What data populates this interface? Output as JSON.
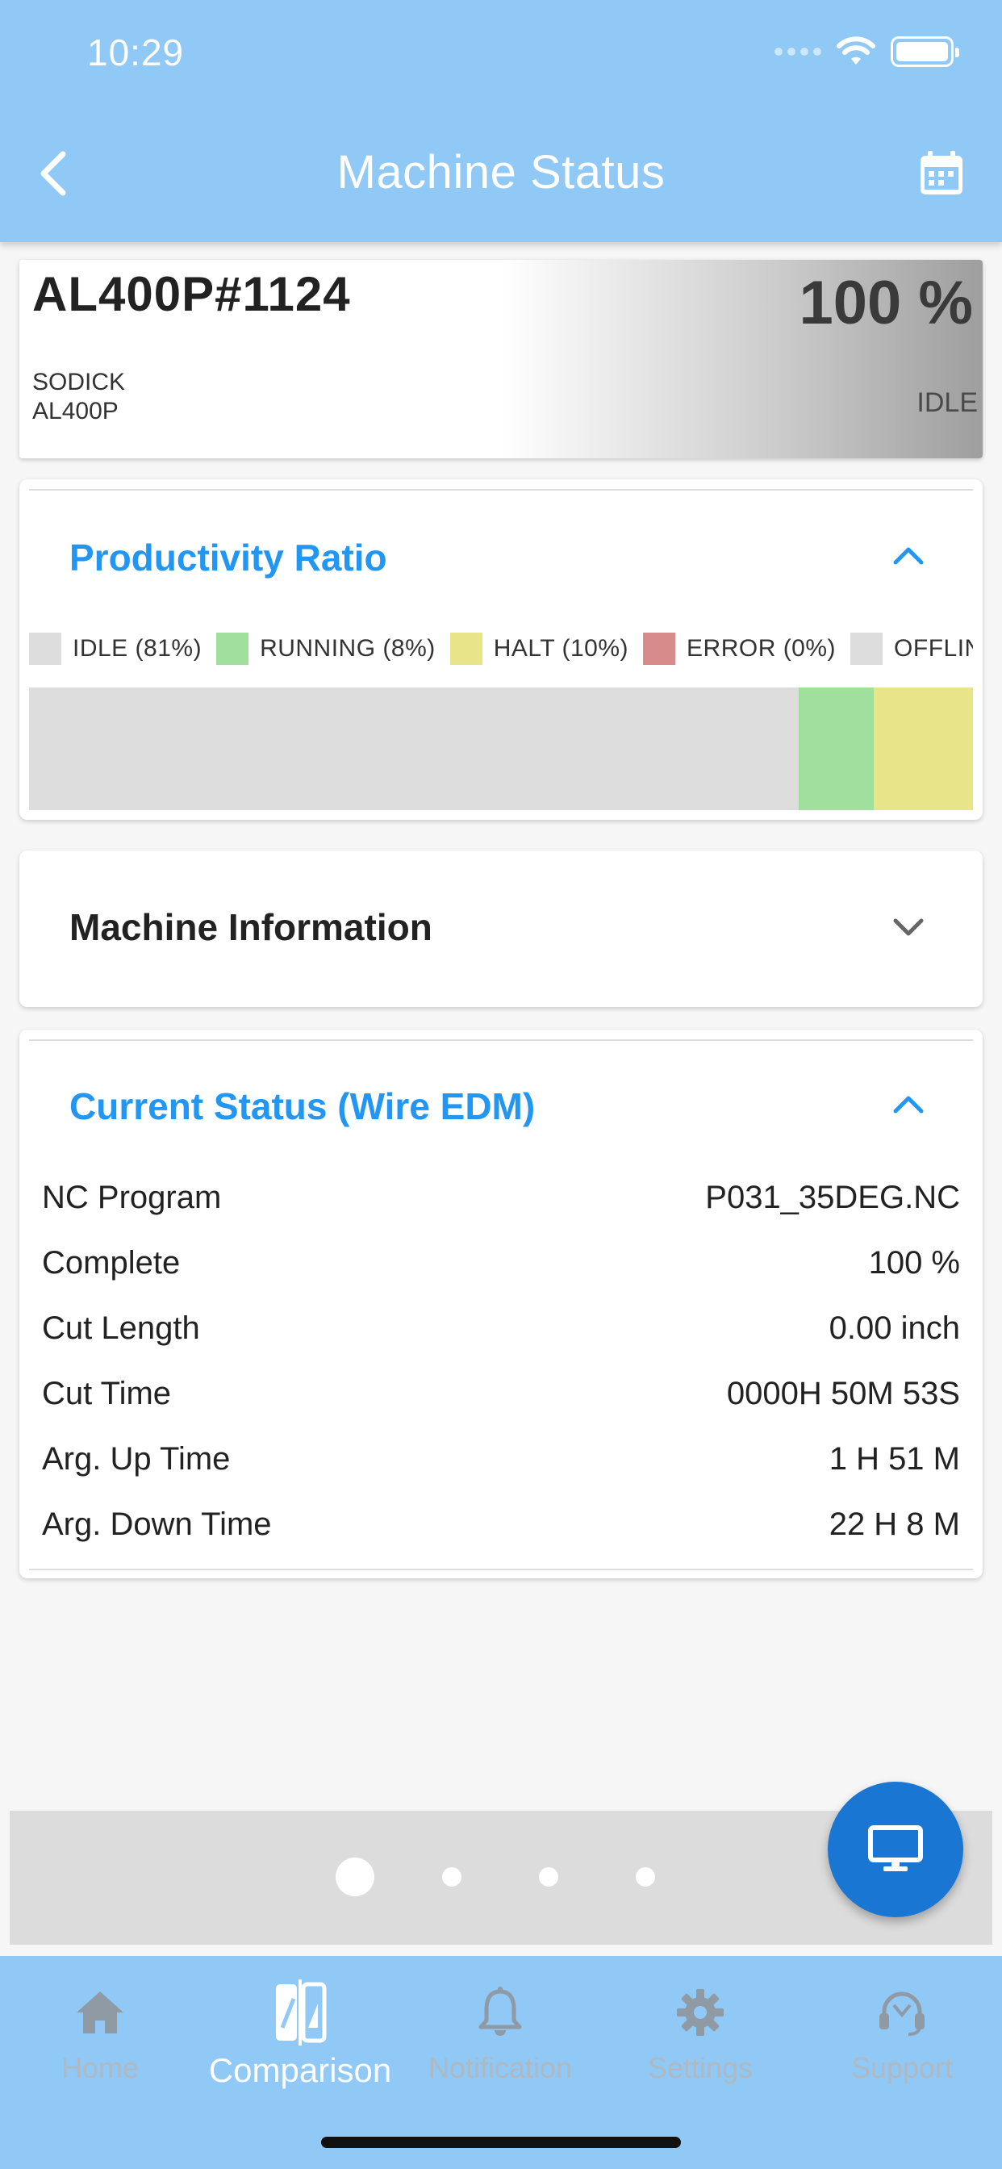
{
  "status_bar": {
    "time": "10:29"
  },
  "header": {
    "title": "Machine Status"
  },
  "machine": {
    "id": "AL400P#1124",
    "brand": "SODICK",
    "model": "AL400P",
    "percent": "100 %",
    "state": "IDLE"
  },
  "productivity": {
    "title": "Productivity Ratio",
    "legend": [
      {
        "label": "IDLE (81%)",
        "color": "#dddddd"
      },
      {
        "label": "RUNNING (8%)",
        "color": "#a0e09c"
      },
      {
        "label": "HALT (10%)",
        "color": "#e7e48a"
      },
      {
        "label": "ERROR (0%)",
        "color": "#d88b8b"
      },
      {
        "label": "OFFLINE",
        "color": "#dddddd"
      }
    ],
    "segments": [
      {
        "name": "idle",
        "fraction": 0.815,
        "color": "#dddddd"
      },
      {
        "name": "running",
        "fraction": 0.08,
        "color": "#a0e09c"
      },
      {
        "name": "halt",
        "fraction": 0.105,
        "color": "#e7e48a"
      }
    ]
  },
  "machine_info": {
    "title": "Machine Information"
  },
  "current_status": {
    "title": "Current Status (Wire EDM)",
    "rows": [
      {
        "label": "NC Program",
        "value": "P031_35DEG.NC"
      },
      {
        "label": "Complete",
        "value": "100 %"
      },
      {
        "label": "Cut Length",
        "value": "0.00 inch"
      },
      {
        "label": "Cut Time",
        "value": "0000H 50M 53S"
      },
      {
        "label": "Arg. Up Time",
        "value": "1 H 51 M"
      },
      {
        "label": "Arg. Down Time",
        "value": "22 H 8 M"
      }
    ]
  },
  "pager": {
    "active_index": 0,
    "count": 4
  },
  "nav": {
    "items": [
      {
        "label": "Home",
        "icon": "home-icon"
      },
      {
        "label": "Comparison",
        "icon": "comparison-icon"
      },
      {
        "label": "Notification",
        "icon": "bell-icon"
      },
      {
        "label": "Settings",
        "icon": "gear-icon"
      },
      {
        "label": "Support",
        "icon": "headset-icon"
      }
    ],
    "active": "Comparison"
  },
  "colors": {
    "header": "#90c8f6",
    "accent": "#2196f3",
    "fab": "#1976d2"
  }
}
